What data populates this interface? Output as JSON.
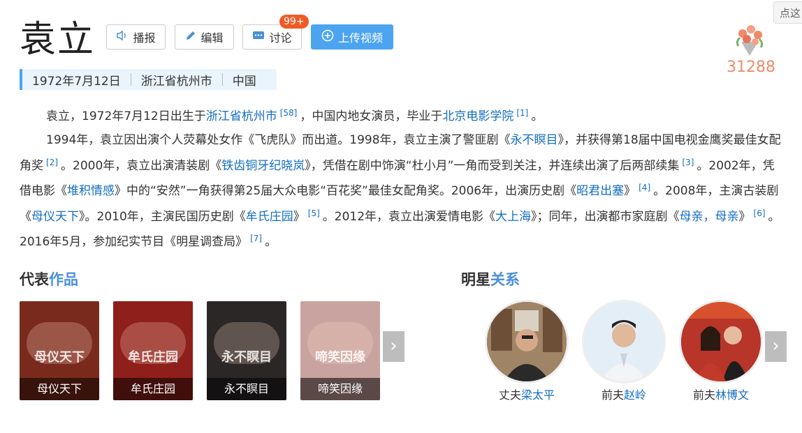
{
  "header": {
    "title": "袁立",
    "play_label": "播报",
    "edit_label": "编辑",
    "discuss_label": "讨论",
    "discuss_badge": "99+",
    "upload_label": "上传视频",
    "side_tip": "点这",
    "flower_count": "31288"
  },
  "infobar": {
    "birth": "1972年7月12日",
    "place": "浙江省杭州市",
    "country": "中国"
  },
  "intro": {
    "p1": [
      {
        "t": "袁立，1972年7月12日出生于"
      },
      {
        "t": "浙江省杭州市",
        "link": true
      },
      {
        "t": "[58]",
        "sup": true
      },
      {
        "t": "，中国内地女演员，毕业于"
      },
      {
        "t": "北京电影学院",
        "link": true
      },
      {
        "t": "[1]",
        "sup": true
      },
      {
        "t": "。"
      }
    ],
    "p2": [
      {
        "t": "1994年，袁立因出演个人荧幕处女作《飞虎队》而出道。1998年，袁立主演了警匪剧《"
      },
      {
        "t": "永不瞑目",
        "link": true
      },
      {
        "t": "》，并获得第18届中国电视金鹰奖最佳女配角奖"
      },
      {
        "t": "[2]",
        "sup": true
      },
      {
        "t": "。2000年，袁立出演清装剧《"
      },
      {
        "t": "铁齿铜牙纪晓岚",
        "link": true
      },
      {
        "t": "》，凭借在剧中饰演“杜小月”一角而受到关注，并连续出演了后两部续集"
      },
      {
        "t": "[3]",
        "sup": true
      },
      {
        "t": "。2002年，凭借电影《"
      },
      {
        "t": "堆积情感",
        "link": true
      },
      {
        "t": "》中的“安然”一角获得第25届大众电影“百花奖”最佳女配角奖。2006年，出演历史剧《"
      },
      {
        "t": "昭君出塞",
        "link": true
      },
      {
        "t": "》"
      },
      {
        "t": "[4]",
        "sup": true
      },
      {
        "t": "。2008年，主演古装剧《"
      },
      {
        "t": "母仪天下",
        "link": true
      },
      {
        "t": "》。2010年，主演民国历史剧《"
      },
      {
        "t": "牟氏庄园",
        "link": true
      },
      {
        "t": "》"
      },
      {
        "t": "[5]",
        "sup": true
      },
      {
        "t": "。2012年，袁立出演爱情电影《"
      },
      {
        "t": "大上海",
        "link": true
      },
      {
        "t": "》；同年，出演都市家庭剧《"
      },
      {
        "t": "母亲，母亲",
        "link": true
      },
      {
        "t": "》"
      },
      {
        "t": "[6]",
        "sup": true
      },
      {
        "t": "。2016年5月，参加纪实节目《明星调查局》"
      },
      {
        "t": "[7]",
        "sup": true
      },
      {
        "t": "。"
      }
    ]
  },
  "works": {
    "title_a": "代表",
    "title_b": "作品",
    "items": [
      {
        "label": "母仪天下",
        "bg": "#7a2a1c",
        "overlay": "母仪天下"
      },
      {
        "label": "牟氏庄园",
        "bg": "#8e1f1a",
        "overlay": "牟氏庄园"
      },
      {
        "label": "永不瞑目",
        "bg": "#2b2727",
        "overlay": "永不瞑目"
      },
      {
        "label": "啼笑因缘",
        "bg": "#c9a3a0",
        "overlay": "啼笑因缘"
      }
    ]
  },
  "relations": {
    "title_a": "明星",
    "title_b": "关系",
    "items": [
      {
        "role": "丈夫",
        "name": "梁太平"
      },
      {
        "role": "前夫",
        "name": "赵岭"
      },
      {
        "role": "前夫",
        "name": "林博文"
      }
    ]
  },
  "colors": {
    "accent": "#4ca4f0",
    "link": "#136ec2",
    "badge": "#f15a24"
  }
}
